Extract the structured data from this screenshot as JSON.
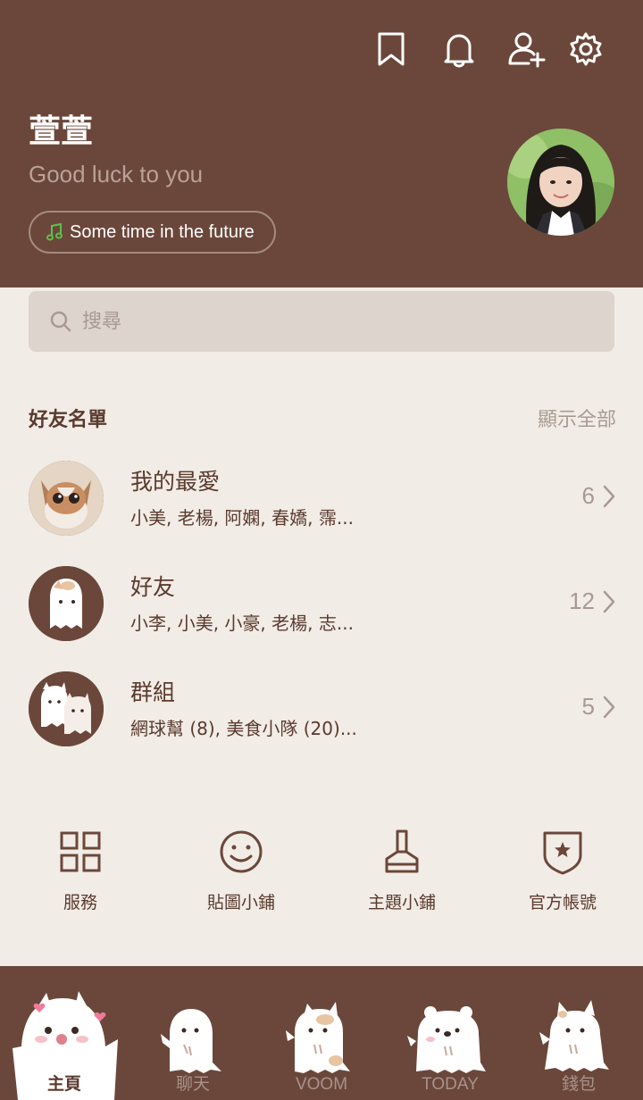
{
  "header": {
    "name": "萱萱",
    "status": "Good luck to you",
    "music": "Some time in the future",
    "icons": [
      "bookmark-icon",
      "bell-icon",
      "add-friend-icon",
      "settings-icon"
    ]
  },
  "search": {
    "placeholder": "搜尋"
  },
  "friends": {
    "title": "好友名單",
    "show_all": "顯示全部",
    "rows": [
      {
        "title": "我的最愛",
        "sub": "小美, 老楊, 阿嫻, 春嬌, 霈...",
        "count": "6"
      },
      {
        "title": "好友",
        "sub": "小李, 小美, 小豪, 老楊, 志...",
        "count": "12"
      },
      {
        "title": "群組",
        "sub": "網球幫 (8), 美食小隊 (20)...",
        "count": "5"
      }
    ]
  },
  "services": [
    {
      "label": "服務",
      "icon": "grid-icon"
    },
    {
      "label": "貼圖小鋪",
      "icon": "smiley-icon"
    },
    {
      "label": "主題小鋪",
      "icon": "brush-icon"
    },
    {
      "label": "官方帳號",
      "icon": "shield-star-icon"
    }
  ],
  "nav": [
    {
      "label": "主頁"
    },
    {
      "label": "聊天"
    },
    {
      "label": "VOOM"
    },
    {
      "label": "TODAY"
    },
    {
      "label": "錢包"
    }
  ],
  "colors": {
    "header_bg": "#6b473b",
    "page_bg": "#f2ece6",
    "text": "#5a3a2e",
    "muted": "#a89a92"
  }
}
